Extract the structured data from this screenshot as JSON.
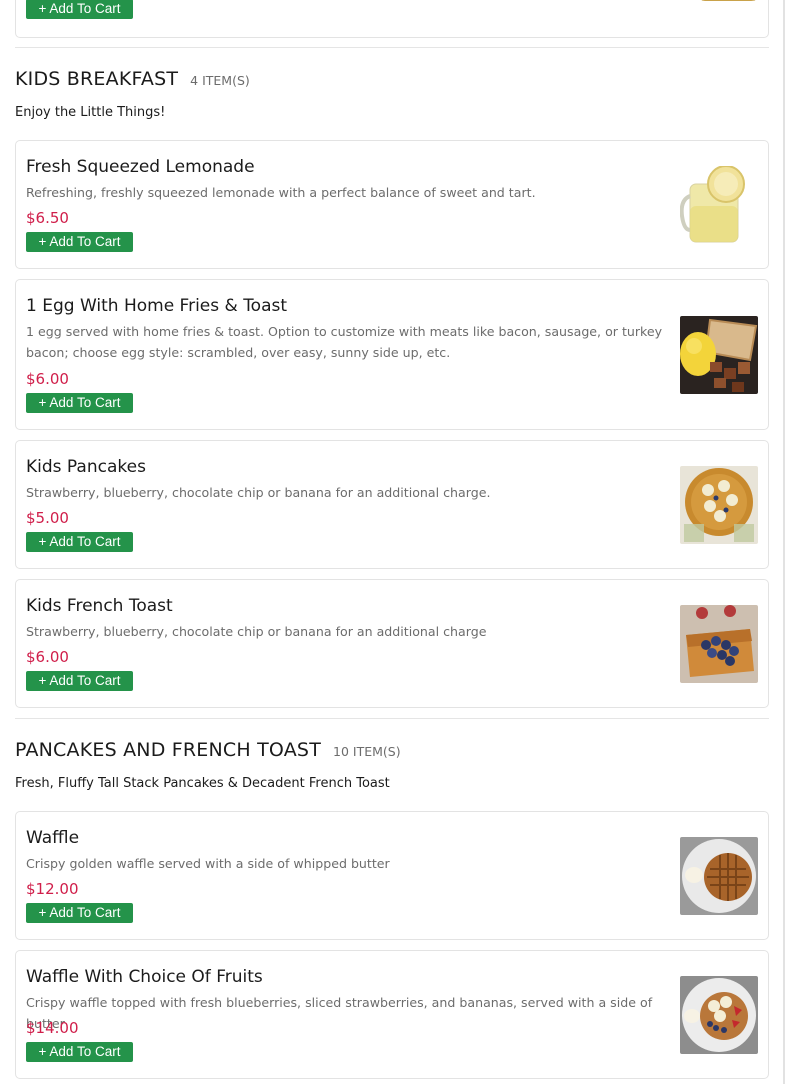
{
  "add_to_cart_label": "+ Add To Cart",
  "colors": {
    "price": "#d01e4a",
    "button": "#24934a",
    "border": "#e3e3e3"
  },
  "sections": [
    {
      "title": "KIDS BREAKFAST",
      "count": "4 ITEM(S)",
      "subtitle": "Enjoy the Little Things!",
      "items": [
        {
          "name": "Fresh Squeezed Lemonade",
          "description": "Refreshing, freshly squeezed lemonade with a perfect balance of sweet and tart.",
          "price": "$6.50",
          "image": "lemonade-image"
        },
        {
          "name": "1 Egg With Home Fries & Toast",
          "description": "1 egg served with home fries & toast. Option to customize with meats like bacon, sausage, or turkey bacon; choose egg style: scrambled, over easy, sunny side up, etc.",
          "price": "$6.00",
          "image": "egg-fries-toast-image"
        },
        {
          "name": "Kids Pancakes",
          "description": "Strawberry, blueberry, chocolate chip or banana for an additional charge.",
          "price": "$5.00",
          "image": "kids-pancakes-image"
        },
        {
          "name": "Kids French Toast",
          "description": "Strawberry, blueberry, chocolate chip or banana for an additional charge",
          "price": "$6.00",
          "image": "kids-french-toast-image"
        }
      ]
    },
    {
      "title": "PANCAKES AND FRENCH TOAST",
      "count": "10 ITEM(S)",
      "subtitle": "Fresh, Fluffy Tall Stack Pancakes & Decadent French Toast",
      "items": [
        {
          "name": "Waffle",
          "description": "Crispy golden waffle served with a side of whipped butter",
          "price": "$12.00",
          "image": "waffle-image"
        },
        {
          "name": "Waffle With Choice Of Fruits",
          "description": "Crispy waffle topped with fresh blueberries, sliced strawberries, and bananas, served with a side of butter",
          "price": "$14.00",
          "image": "waffle-fruits-image"
        }
      ]
    }
  ]
}
